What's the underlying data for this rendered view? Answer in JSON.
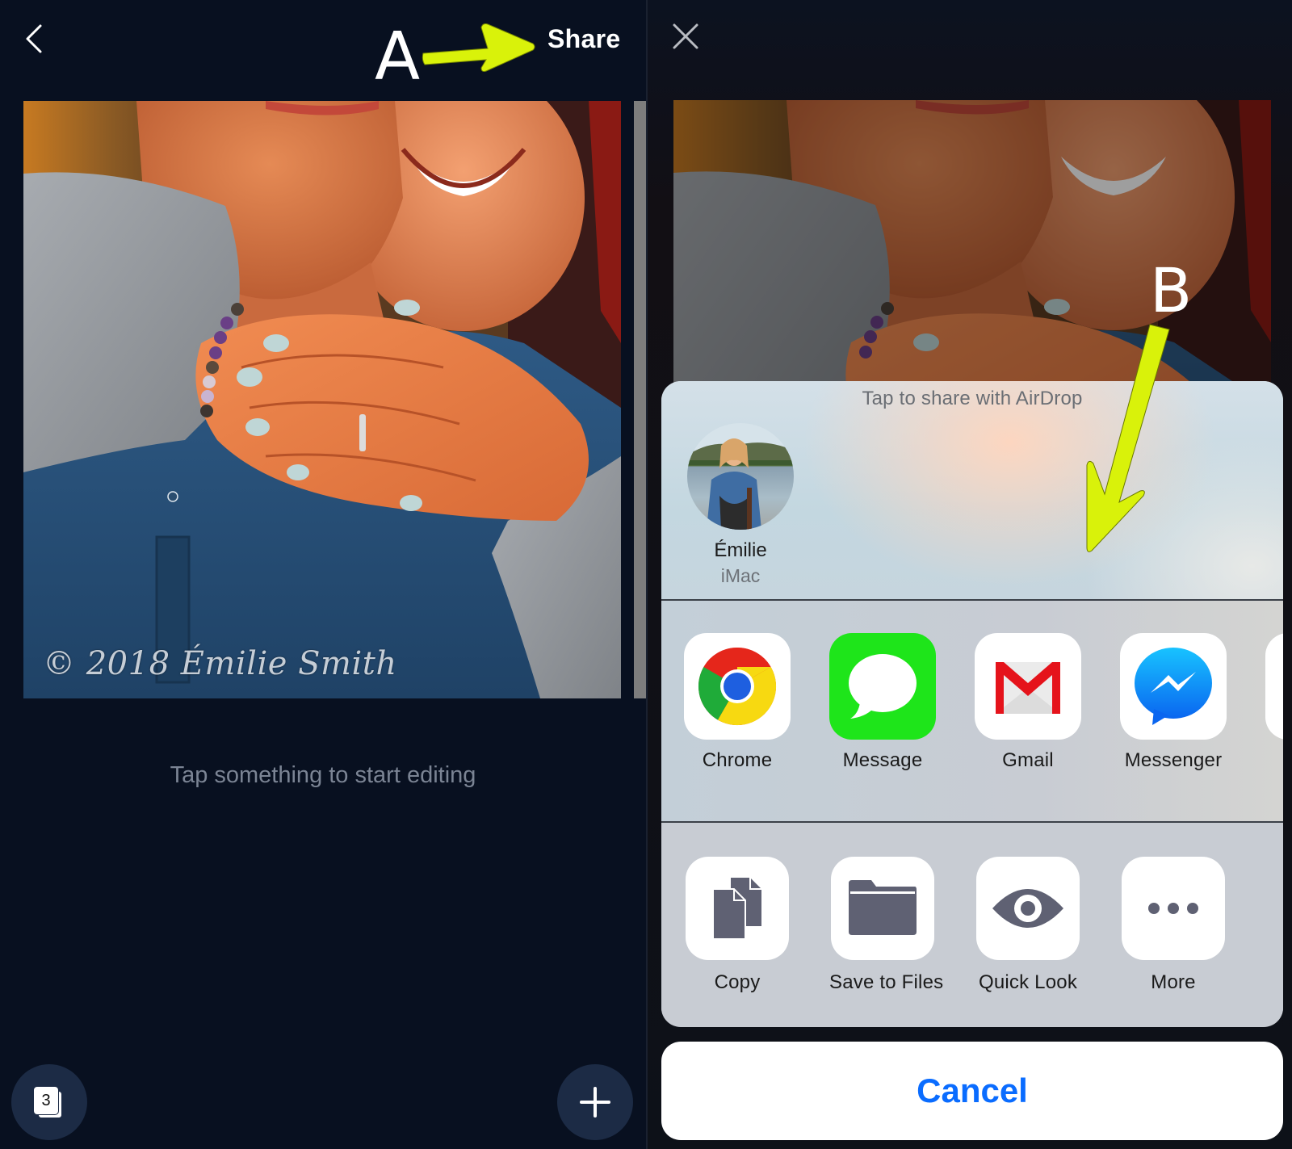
{
  "left_screen": {
    "header": {
      "back_icon": "chevron-left-icon",
      "share_label": "Share"
    },
    "photo": {
      "description": "Couple embracing, woman's hand with engagement ring on man's chest",
      "watermark": "© 2018 Émilie Smith"
    },
    "hint": "Tap something to start editing",
    "bottom_bar": {
      "pages_count": "3",
      "pages_icon": "pages-stack-icon",
      "add_icon": "plus-icon"
    }
  },
  "right_screen": {
    "header": {
      "close_icon": "close-icon"
    },
    "share_sheet": {
      "airdrop_title": "Tap to share with AirDrop",
      "airdrop_contacts": [
        {
          "name": "Émilie",
          "device": "iMac"
        }
      ],
      "apps": [
        {
          "label": "Chrome",
          "icon": "chrome-icon"
        },
        {
          "label": "Message",
          "icon": "messages-icon"
        },
        {
          "label": "Gmail",
          "icon": "gmail-icon"
        },
        {
          "label": "Messenger",
          "icon": "messenger-icon"
        },
        {
          "label": "",
          "icon": "partially-visible-app-icon"
        }
      ],
      "actions": [
        {
          "label": "Copy",
          "icon": "copy-icon"
        },
        {
          "label": "Save to Files",
          "icon": "folder-icon"
        },
        {
          "label": "Quick Look",
          "icon": "eye-icon"
        },
        {
          "label": "More",
          "icon": "more-icon"
        }
      ],
      "cancel_label": "Cancel"
    }
  },
  "annotations": {
    "a_label": "A",
    "b_label": "B",
    "arrow_color": "#d9f20a"
  },
  "colors": {
    "background": "#081020",
    "fab": "#1c2b45",
    "ios_blue": "#0a6cff",
    "message_green": "#1ee51a",
    "sheet_gray": "#c8ccd3"
  }
}
